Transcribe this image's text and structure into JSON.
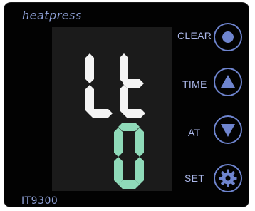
{
  "panel": {
    "brand": "heatpress",
    "model": "IT9300"
  },
  "display": {
    "top_readout": "Lt",
    "bottom_readout": "0"
  },
  "buttons": [
    {
      "label": "CLEAR",
      "icon": "circle-icon"
    },
    {
      "label": "TIME",
      "icon": "triangle-up-icon"
    },
    {
      "label": "AT",
      "icon": "triangle-down-icon"
    },
    {
      "label": "SET",
      "icon": "gear-icon"
    }
  ],
  "colors": {
    "panel": "#020202",
    "screen": "#1b1b1b",
    "accent": "#6f85cf",
    "label": "#aab6e8",
    "top_digits": "#f4f4f4",
    "bottom_digits": "#8fdab9"
  }
}
